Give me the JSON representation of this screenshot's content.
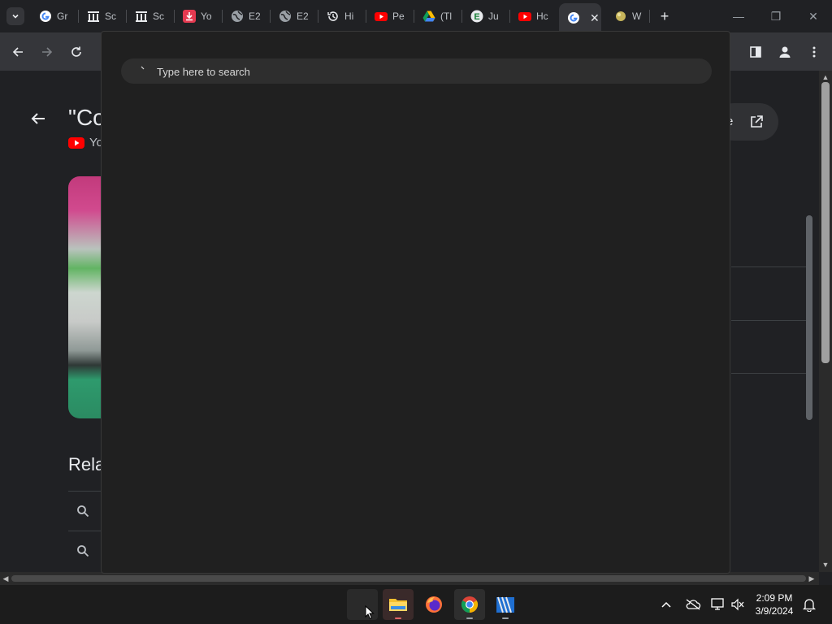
{
  "tabs": [
    {
      "label": "Gr",
      "icon": "google-icon"
    },
    {
      "label": "Sc",
      "icon": "institution-icon"
    },
    {
      "label": "Sc",
      "icon": "institution-icon"
    },
    {
      "label": "Yo",
      "icon": "download-icon"
    },
    {
      "label": "E2",
      "icon": "globe-icon"
    },
    {
      "label": "E2",
      "icon": "globe-icon"
    },
    {
      "label": "Hi",
      "icon": "history-icon"
    },
    {
      "label": "Pe",
      "icon": "youtube-icon"
    },
    {
      "label": "(Tl",
      "icon": "google-drive-icon"
    },
    {
      "label": "Ju",
      "icon": "e-icon"
    },
    {
      "label": "Hc",
      "icon": "youtube-icon"
    },
    {
      "label": "",
      "icon": "google-icon",
      "active": true
    },
    {
      "label": "W",
      "icon": "ball-icon"
    }
  ],
  "page": {
    "title": "\"Co",
    "source": "Yo",
    "related_heading": "Rela",
    "open_button_label": "e"
  },
  "search_popup": {
    "placeholder": "Type here to search"
  },
  "taskbar": {
    "apps": [
      "search",
      "file-explorer",
      "firefox",
      "chrome",
      "video-editor"
    ],
    "time": "2:09 PM",
    "date": "3/9/2024"
  },
  "colors": {
    "page_bg": "#202124",
    "toolbar_bg": "#35363a",
    "popup_bg": "#202020",
    "taskbar_bg": "#1c1c1c",
    "youtube_red": "#ff0000"
  }
}
